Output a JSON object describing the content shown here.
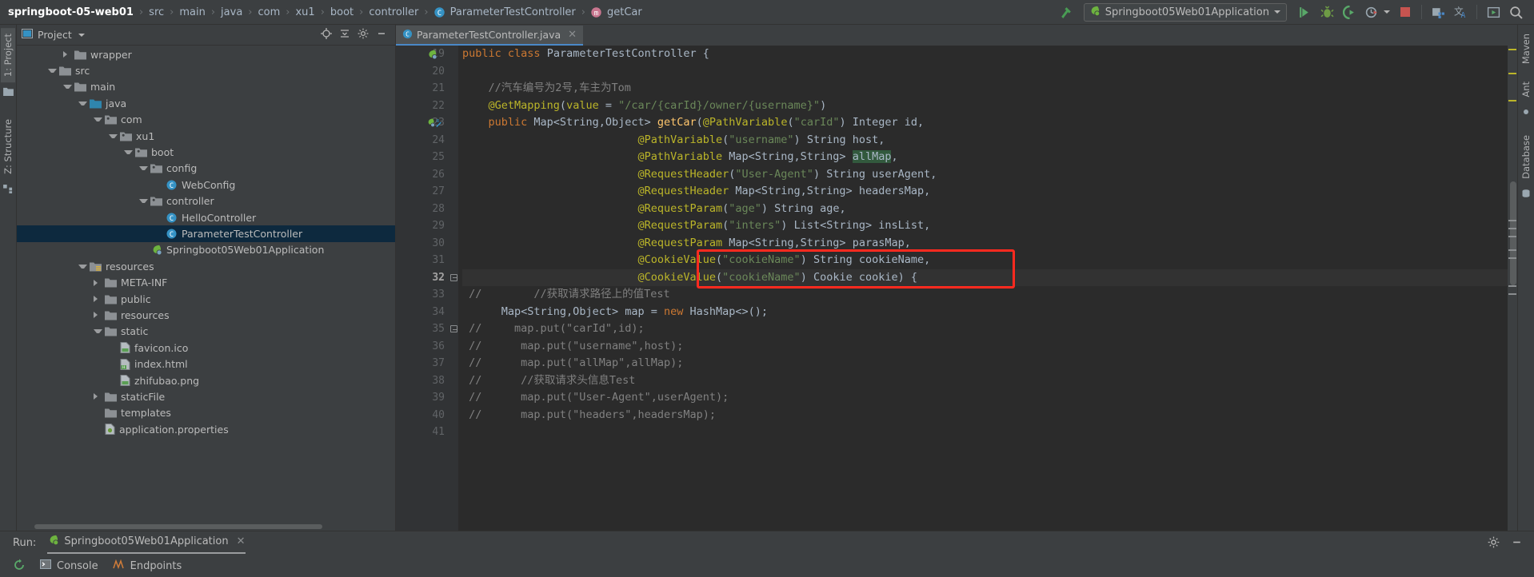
{
  "breadcrumb": {
    "items": [
      {
        "label": "springboot-05-web01",
        "icon": "",
        "root": true
      },
      {
        "label": "src",
        "icon": ""
      },
      {
        "label": "main",
        "icon": ""
      },
      {
        "label": "java",
        "icon": ""
      },
      {
        "label": "com",
        "icon": ""
      },
      {
        "label": "xu1",
        "icon": ""
      },
      {
        "label": "boot",
        "icon": ""
      },
      {
        "label": "controller",
        "icon": ""
      },
      {
        "label": "ParameterTestController",
        "icon": "class-icon"
      },
      {
        "label": "getCar",
        "icon": "method-icon"
      }
    ]
  },
  "toolbar": {
    "build_icon": "hammer-icon",
    "run_config": "Springboot05Web01Application",
    "run_config_icon": "spring-boot-icon",
    "dropdown_icon": "chevron-down-icon",
    "actions": [
      {
        "name": "run-button",
        "icon": "run-icon",
        "color": "#59a869"
      },
      {
        "name": "debug-button",
        "icon": "debug-icon",
        "color": "#6e9b45"
      },
      {
        "name": "run-with-coverage-button",
        "icon": "coverage-icon",
        "color": "#59a869"
      },
      {
        "name": "profiler-button",
        "icon": "profiler-icon",
        "color": "#9aa7b0"
      },
      {
        "name": "stop-button",
        "icon": "stop-icon",
        "color": "#c75450"
      },
      {
        "name": "update-app-button",
        "icon": "update-running-app-icon",
        "color": "#7a9cc6"
      },
      {
        "name": "translate-button",
        "icon": "translate-icon",
        "color": "#9aa7b0"
      },
      {
        "name": "run-anything-button",
        "icon": "run-anything-icon",
        "color": "#59a869"
      },
      {
        "name": "search-everywhere-button",
        "icon": "search-icon",
        "color": "#b5b5b5"
      }
    ]
  },
  "left_rail": {
    "items": [
      {
        "label": "1: Project",
        "active": true
      },
      {
        "label": "Z: Structure",
        "active": false
      }
    ],
    "icons": [
      "folder-icon",
      "structure-icon"
    ]
  },
  "right_rail": {
    "items": [
      {
        "label": "Maven"
      },
      {
        "label": "Ant"
      },
      {
        "label": "Database"
      }
    ]
  },
  "project_panel": {
    "title": "Project",
    "title_icon": "project-view-icon",
    "dropdown_icon": "chevron-down-icon",
    "actions": [
      {
        "name": "select-opened-file-button",
        "icon": "crosshair-icon"
      },
      {
        "name": "collapse-all-button",
        "icon": "collapse-all-icon"
      },
      {
        "name": "settings-button",
        "icon": "gear-icon"
      },
      {
        "name": "hide-button",
        "icon": "minimize-icon"
      }
    ],
    "tree": [
      {
        "label": "wrapper",
        "indent": 2,
        "arrow": "right",
        "icon": "folder-icon",
        "selected": false
      },
      {
        "label": "src",
        "indent": 1,
        "arrow": "down",
        "icon": "folder-icon",
        "selected": false
      },
      {
        "label": "main",
        "indent": 2,
        "arrow": "down",
        "icon": "folder-icon",
        "selected": false
      },
      {
        "label": "java",
        "indent": 3,
        "arrow": "down",
        "icon": "source-root-icon",
        "selected": false
      },
      {
        "label": "com",
        "indent": 4,
        "arrow": "down",
        "icon": "package-icon",
        "selected": false
      },
      {
        "label": "xu1",
        "indent": 5,
        "arrow": "down",
        "icon": "package-icon",
        "selected": false
      },
      {
        "label": "boot",
        "indent": 6,
        "arrow": "down",
        "icon": "package-icon",
        "selected": false
      },
      {
        "label": "config",
        "indent": 7,
        "arrow": "down",
        "icon": "package-icon",
        "selected": false
      },
      {
        "label": "WebConfig",
        "indent": 8,
        "arrow": "none",
        "icon": "class-icon",
        "selected": false
      },
      {
        "label": "controller",
        "indent": 7,
        "arrow": "down",
        "icon": "package-icon",
        "selected": false
      },
      {
        "label": "HelloController",
        "indent": 8,
        "arrow": "none",
        "icon": "class-icon",
        "selected": false
      },
      {
        "label": "ParameterTestController",
        "indent": 8,
        "arrow": "none",
        "icon": "class-icon",
        "selected": true
      },
      {
        "label": "Springboot05Web01Application",
        "indent": 7,
        "arrow": "none",
        "icon": "spring-boot-icon",
        "selected": false
      },
      {
        "label": "resources",
        "indent": 3,
        "arrow": "down",
        "icon": "resource-root-icon",
        "selected": false
      },
      {
        "label": "META-INF",
        "indent": 4,
        "arrow": "right",
        "icon": "folder-icon",
        "selected": false
      },
      {
        "label": "public",
        "indent": 4,
        "arrow": "right",
        "icon": "folder-icon",
        "selected": false
      },
      {
        "label": "resources",
        "indent": 4,
        "arrow": "right",
        "icon": "folder-icon",
        "selected": false
      },
      {
        "label": "static",
        "indent": 4,
        "arrow": "down",
        "icon": "folder-icon",
        "selected": false
      },
      {
        "label": "favicon.ico",
        "indent": 5,
        "arrow": "none",
        "icon": "image-file-icon",
        "selected": false
      },
      {
        "label": "index.html",
        "indent": 5,
        "arrow": "none",
        "icon": "html-file-icon",
        "selected": false
      },
      {
        "label": "zhifubao.png",
        "indent": 5,
        "arrow": "none",
        "icon": "image-file-icon",
        "selected": false
      },
      {
        "label": "staticFile",
        "indent": 4,
        "arrow": "right",
        "icon": "folder-icon",
        "selected": false
      },
      {
        "label": "templates",
        "indent": 4,
        "arrow": "none",
        "icon": "folder-icon",
        "selected": false
      },
      {
        "label": "application.properties",
        "indent": 4,
        "arrow": "none",
        "icon": "properties-file-icon",
        "selected": false
      }
    ]
  },
  "editor": {
    "tab": {
      "label": "ParameterTestController.java",
      "icon": "class-icon",
      "close_icon": "close-icon"
    },
    "first_line": 19,
    "current_line": 32,
    "lines": [
      {
        "n": 19,
        "gutter_icon": "spring-bean-icon",
        "fold": false,
        "comment_prefix": "",
        "tokens": [
          {
            "t": "public ",
            "c": "kw"
          },
          {
            "t": "class ",
            "c": "kw"
          },
          {
            "t": "ParameterTestController ",
            "c": "ty"
          },
          {
            "t": "{",
            "c": "pn"
          }
        ],
        "indent": 0
      },
      {
        "n": 20,
        "gutter_icon": "",
        "fold": false,
        "tokens": [],
        "indent": 0
      },
      {
        "n": 21,
        "gutter_icon": "",
        "fold": false,
        "tokens": [
          {
            "t": "//汽车编号为2号,车主为Tom",
            "c": "cm"
          }
        ],
        "indent": 4
      },
      {
        "n": 22,
        "gutter_icon": "",
        "fold": false,
        "tokens": [
          {
            "t": "@GetMapping",
            "c": "an"
          },
          {
            "t": "(",
            "c": "pn"
          },
          {
            "t": "value",
            "c": "an"
          },
          {
            "t": " = ",
            "c": "pn"
          },
          {
            "t": "\"/car/{carId}/owner/{username}\"",
            "c": "str"
          },
          {
            "t": ")",
            "c": "pn"
          }
        ],
        "indent": 4
      },
      {
        "n": 23,
        "gutter_icon": "spring-request-mapping-icon",
        "fold": false,
        "tokens": [
          {
            "t": "public ",
            "c": "kw"
          },
          {
            "t": "Map<String,Object> ",
            "c": "ty"
          },
          {
            "t": "getCar",
            "c": "mth"
          },
          {
            "t": "(",
            "c": "pn"
          },
          {
            "t": "@PathVariable",
            "c": "an"
          },
          {
            "t": "(",
            "c": "pn"
          },
          {
            "t": "\"carId\"",
            "c": "str"
          },
          {
            "t": ") ",
            "c": "pn"
          },
          {
            "t": "Integer id,",
            "c": "ty"
          }
        ],
        "indent": 4
      },
      {
        "n": 24,
        "gutter_icon": "",
        "fold": false,
        "tokens": [
          {
            "t": "@PathVariable",
            "c": "an"
          },
          {
            "t": "(",
            "c": "pn"
          },
          {
            "t": "\"username\"",
            "c": "str"
          },
          {
            "t": ") ",
            "c": "pn"
          },
          {
            "t": "String host,",
            "c": "ty"
          }
        ],
        "indent": 27
      },
      {
        "n": 25,
        "gutter_icon": "",
        "fold": false,
        "tokens": [
          {
            "t": "@PathVariable ",
            "c": "an"
          },
          {
            "t": "Map<String,String> ",
            "c": "ty"
          },
          {
            "t": "allMap",
            "c": "hl"
          },
          {
            "t": ",",
            "c": "pn"
          }
        ],
        "indent": 27
      },
      {
        "n": 26,
        "gutter_icon": "",
        "fold": false,
        "tokens": [
          {
            "t": "@RequestHeader",
            "c": "an"
          },
          {
            "t": "(",
            "c": "pn"
          },
          {
            "t": "\"User-Agent\"",
            "c": "str"
          },
          {
            "t": ") ",
            "c": "pn"
          },
          {
            "t": "String userAgent,",
            "c": "ty"
          }
        ],
        "indent": 27
      },
      {
        "n": 27,
        "gutter_icon": "",
        "fold": false,
        "tokens": [
          {
            "t": "@RequestHeader ",
            "c": "an"
          },
          {
            "t": "Map<String,String> ",
            "c": "ty"
          },
          {
            "t": "headersMap,",
            "c": "ty"
          }
        ],
        "indent": 27
      },
      {
        "n": 28,
        "gutter_icon": "",
        "fold": false,
        "tokens": [
          {
            "t": "@RequestParam",
            "c": "an"
          },
          {
            "t": "(",
            "c": "pn"
          },
          {
            "t": "\"age\"",
            "c": "str"
          },
          {
            "t": ") ",
            "c": "pn"
          },
          {
            "t": "String age,",
            "c": "ty"
          }
        ],
        "indent": 27
      },
      {
        "n": 29,
        "gutter_icon": "",
        "fold": false,
        "tokens": [
          {
            "t": "@RequestParam",
            "c": "an"
          },
          {
            "t": "(",
            "c": "pn"
          },
          {
            "t": "\"inters\"",
            "c": "str"
          },
          {
            "t": ") ",
            "c": "pn"
          },
          {
            "t": "List<String> insList,",
            "c": "ty"
          }
        ],
        "indent": 27
      },
      {
        "n": 30,
        "gutter_icon": "",
        "fold": false,
        "tokens": [
          {
            "t": "@RequestParam ",
            "c": "an"
          },
          {
            "t": "Map<String,String> ",
            "c": "ty"
          },
          {
            "t": "parasMap,",
            "c": "ty"
          }
        ],
        "indent": 27
      },
      {
        "n": 31,
        "gutter_icon": "",
        "fold": false,
        "tokens": [
          {
            "t": "@CookieValue",
            "c": "an"
          },
          {
            "t": "(",
            "c": "pn"
          },
          {
            "t": "\"cookieName\"",
            "c": "str"
          },
          {
            "t": ") ",
            "c": "pn"
          },
          {
            "t": "String cookieName,",
            "c": "ty"
          }
        ],
        "indent": 27
      },
      {
        "n": 32,
        "gutter_icon": "",
        "fold": true,
        "tokens": [
          {
            "t": "@CookieValue",
            "c": "an"
          },
          {
            "t": "(",
            "c": "pn"
          },
          {
            "t": "\"cookieName\"",
            "c": "str"
          },
          {
            "t": ") ",
            "c": "pn"
          },
          {
            "t": "Cookie cookie) {",
            "c": "ty"
          }
        ],
        "indent": 27
      },
      {
        "n": 33,
        "gutter_icon": "",
        "fold": false,
        "tokens": [
          {
            "t": "//        //获取请求路径上的值Test",
            "c": "cm"
          }
        ],
        "indent": 1
      },
      {
        "n": 34,
        "gutter_icon": "",
        "fold": false,
        "tokens": [
          {
            "t": "Map<String,Object> ",
            "c": "ty"
          },
          {
            "t": "map = ",
            "c": "pn"
          },
          {
            "t": "new ",
            "c": "kw"
          },
          {
            "t": "HashMap<>();",
            "c": "ty"
          }
        ],
        "indent": 6
      },
      {
        "n": 35,
        "gutter_icon": "",
        "fold": true,
        "tokens": [
          {
            "t": "//     map.put(\"carId\",id);",
            "c": "cm"
          }
        ],
        "indent": 1
      },
      {
        "n": 36,
        "gutter_icon": "",
        "fold": false,
        "tokens": [
          {
            "t": "//      map.put(\"username\",host);",
            "c": "cm"
          }
        ],
        "indent": 1
      },
      {
        "n": 37,
        "gutter_icon": "",
        "fold": false,
        "tokens": [
          {
            "t": "//      map.put(\"allMap\",allMap);",
            "c": "cm"
          }
        ],
        "indent": 1
      },
      {
        "n": 38,
        "gutter_icon": "",
        "fold": false,
        "tokens": [
          {
            "t": "//      //获取请求头信息Test",
            "c": "cm"
          }
        ],
        "indent": 1
      },
      {
        "n": 39,
        "gutter_icon": "",
        "fold": false,
        "tokens": [
          {
            "t": "//      map.put(\"User-Agent\",userAgent);",
            "c": "cm"
          }
        ],
        "indent": 1
      },
      {
        "n": 40,
        "gutter_icon": "",
        "fold": false,
        "tokens": [
          {
            "t": "//      map.put(\"headers\",headersMap);",
            "c": "cm"
          }
        ],
        "indent": 1
      },
      {
        "n": 41,
        "gutter_icon": "",
        "fold": false,
        "tokens": [],
        "indent": 0
      }
    ],
    "annotation_highlight": {
      "color": "#ff2a1f",
      "from_line": 31,
      "to_line": 32
    }
  },
  "run_panel": {
    "label": "Run:",
    "tab": {
      "label": "Springboot05Web01Application",
      "icon": "spring-boot-icon",
      "close_icon": "close-icon"
    },
    "head_actions": [
      {
        "name": "settings-button",
        "icon": "gear-icon"
      },
      {
        "name": "hide-button",
        "icon": "minimize-icon"
      }
    ],
    "rerun_icon": "rerun-icon",
    "subtabs": [
      {
        "label": "Console",
        "icon": "console-icon"
      },
      {
        "label": "Endpoints",
        "icon": "endpoints-icon"
      }
    ]
  },
  "colors": {
    "bg_chrome": "#3c3f41",
    "bg_editor": "#2b2b2b",
    "bg_gutter": "#313335",
    "selection": "#0d293e",
    "accent": "#4a88c7",
    "annotation": "#bbb529",
    "string": "#6a8759",
    "keyword": "#cc7832",
    "comment": "#808080",
    "method": "#ffc66d",
    "highlight_box": "#ff2a1f",
    "search_highlight": "#32593d"
  }
}
